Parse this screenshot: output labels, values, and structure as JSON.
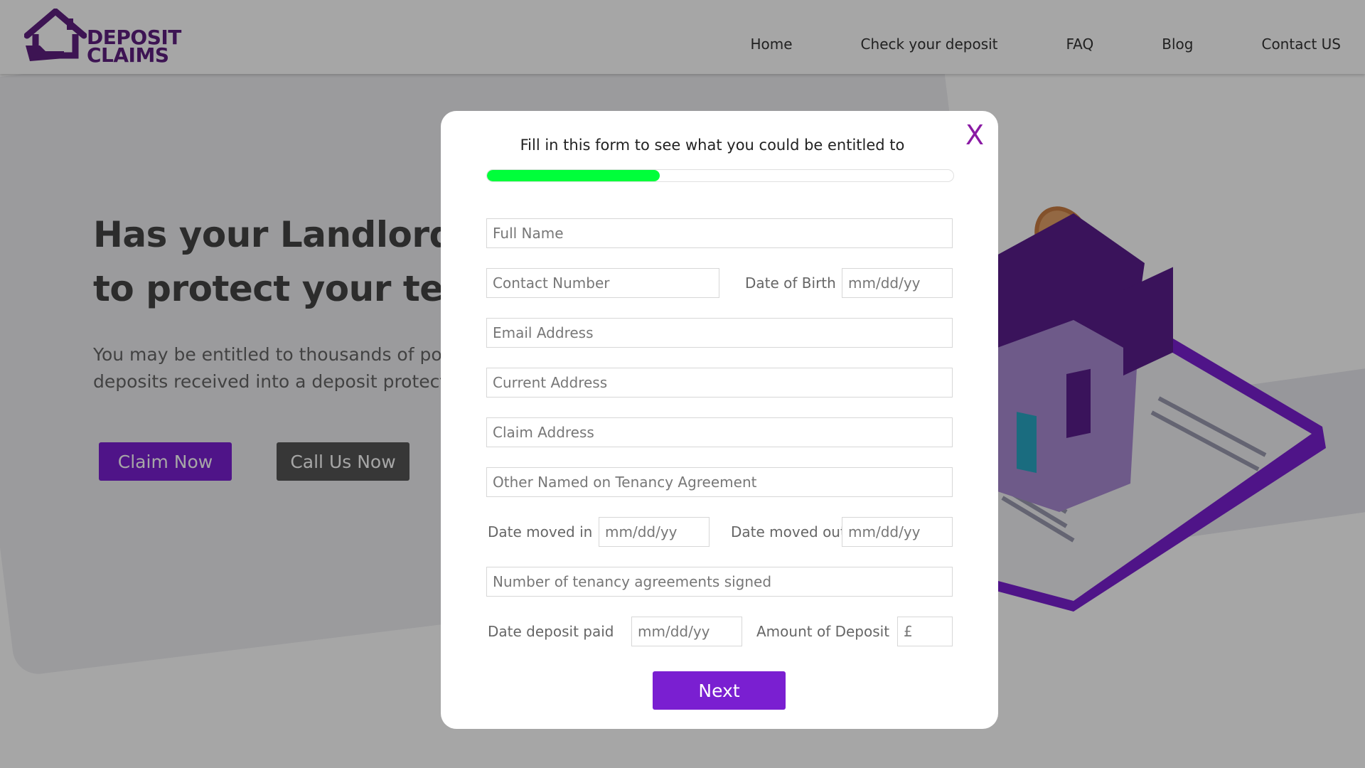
{
  "brand": {
    "line1": "DEPOSIT",
    "line2": "CLAIMS",
    "color": "#5e1f80"
  },
  "nav": {
    "items": [
      "Home",
      "Check your deposit",
      "FAQ",
      "Blog",
      "Contact US"
    ]
  },
  "hero": {
    "title_line1": "Has your Landlord f",
    "title_line2": "to protect your tenc",
    "sub_line1": "You may be entitled to thousands of po",
    "sub_line2": "deposits received into a deposit protect",
    "claim_button": "Claim Now",
    "call_button": "Call Us Now"
  },
  "modal": {
    "close_label": "X",
    "title": "Fill in this form to see what you could be entitled to",
    "progress": 0.37,
    "progress_color": "#00ff3a",
    "fields": {
      "full_name": "Full Name",
      "contact_number": "Contact Number",
      "dob_label": "Date of Birth",
      "dob_placeholder": "mm/dd/yy",
      "email": "Email Address",
      "current_address": "Current Address",
      "claim_address": "Claim Address",
      "other_named": "Other Named on Tenancy Agreement",
      "moved_in_label": "Date moved in",
      "moved_in_placeholder": "mm/dd/yy",
      "moved_out_label": "Date moved out",
      "moved_out_placeholder": "mm/dd/yy",
      "num_agreements": "Number of tenancy agreements signed",
      "deposit_paid_label": "Date deposit paid",
      "deposit_paid_placeholder": "mm/dd/yy",
      "amount_label": "Amount of Deposit",
      "amount_placeholder": "£"
    },
    "next_button": "Next",
    "accent_color": "#7a1fd1"
  }
}
